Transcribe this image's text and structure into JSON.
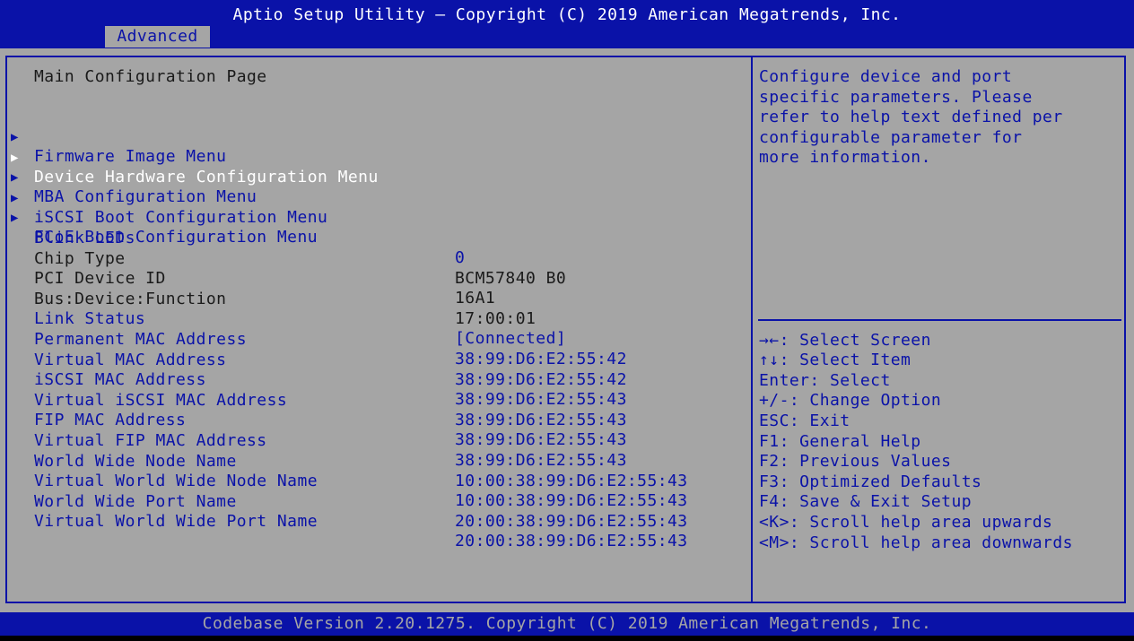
{
  "header": {
    "title": "Aptio Setup Utility – Copyright (C) 2019 American Megatrends, Inc.",
    "active_tab": "Advanced"
  },
  "main": {
    "page_title": "Main Configuration Page",
    "submenus": [
      {
        "label": "Firmware Image Menu",
        "selected": false
      },
      {
        "label": "Device Hardware Configuration Menu",
        "selected": true
      },
      {
        "label": "MBA Configuration Menu",
        "selected": false
      },
      {
        "label": "iSCSI Boot Configuration Menu",
        "selected": false
      },
      {
        "label": "FCoE Boot Configuration Menu",
        "selected": false
      }
    ],
    "settings": [
      {
        "label": "Blink LEDs",
        "value": "0",
        "editable": true
      },
      {
        "label": "Chip Type",
        "value": "BCM57840 B0",
        "editable": false
      },
      {
        "label": "PCI Device ID",
        "value": "16A1",
        "editable": false
      },
      {
        "label": "Bus:Device:Function",
        "value": "17:00:01",
        "editable": false
      },
      {
        "label": "Link Status",
        "value": "[Connected]",
        "editable": true
      },
      {
        "label": "Permanent MAC Address",
        "value": "38:99:D6:E2:55:42",
        "editable": true
      },
      {
        "label": "Virtual MAC Address",
        "value": "38:99:D6:E2:55:42",
        "editable": true
      },
      {
        "label": "iSCSI MAC Address",
        "value": "38:99:D6:E2:55:43",
        "editable": true
      },
      {
        "label": "Virtual iSCSI MAC Address",
        "value": "38:99:D6:E2:55:43",
        "editable": true
      },
      {
        "label": "FIP MAC Address",
        "value": "38:99:D6:E2:55:43",
        "editable": true
      },
      {
        "label": "Virtual FIP MAC Address",
        "value": "38:99:D6:E2:55:43",
        "editable": true
      },
      {
        "label": "World Wide Node Name",
        "value": "10:00:38:99:D6:E2:55:43",
        "editable": true
      },
      {
        "label": "Virtual World Wide Node Name",
        "value": "10:00:38:99:D6:E2:55:43",
        "editable": true
      },
      {
        "label": "World Wide Port Name",
        "value": "20:00:38:99:D6:E2:55:43",
        "editable": true
      },
      {
        "label": "Virtual World Wide Port Name",
        "value": "20:00:38:99:D6:E2:55:43",
        "editable": true
      }
    ]
  },
  "help_panel": {
    "lines": [
      "Configure device and port",
      "specific parameters. Please",
      "refer to help text defined per",
      "configurable parameter for",
      "more information."
    ]
  },
  "key_legend": [
    "→←: Select Screen",
    "↑↓: Select Item",
    "Enter: Select",
    "+/-: Change Option",
    "ESC: Exit",
    "F1: General Help",
    "F2: Previous Values",
    "F3: Optimized Defaults",
    "F4: Save & Exit Setup",
    "<K>: Scroll help area upwards",
    "<M>: Scroll help area downwards"
  ],
  "footer": {
    "text": "Codebase Version 2.20.1275. Copyright (C) 2019 American Megatrends, Inc."
  },
  "colors": {
    "background": "#a5a5a5",
    "accent_blue": "#0a12a8",
    "selected_text": "#ffffff",
    "static_text": "#1a1a1a"
  },
  "icons": {
    "submenu_marker": "triangle-right-icon"
  }
}
